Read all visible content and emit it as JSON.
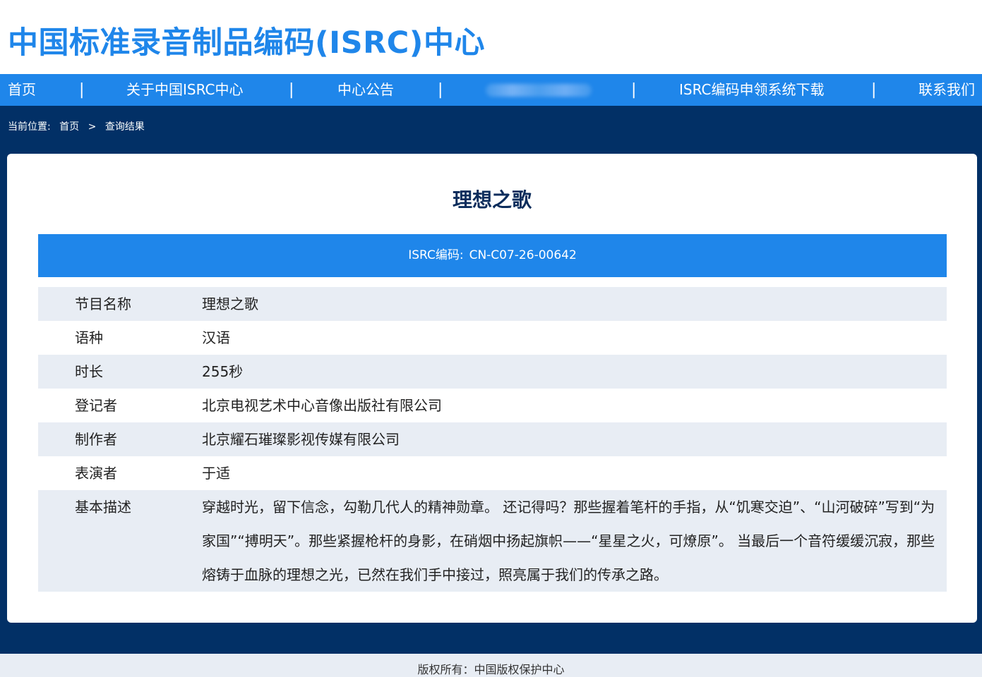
{
  "header": {
    "site_title": "中国标准录音制品编码(ISRC)中心"
  },
  "nav": {
    "items": [
      "首页",
      "关于中国ISRC中心",
      "中心公告",
      "ISRC编码申领系统下载",
      "联系我们"
    ],
    "separator": "|"
  },
  "breadcrumb": {
    "prefix": "当前位置:",
    "home": "首页",
    "arrow": ">",
    "current": "查询结果"
  },
  "record": {
    "title": "理想之歌",
    "isrc_label": "ISRC编码:",
    "isrc_code": "CN-C07-26-00642",
    "fields": [
      {
        "label": "节目名称",
        "value": "理想之歌"
      },
      {
        "label": "语种",
        "value": "汉语"
      },
      {
        "label": "时长",
        "value": "255秒"
      },
      {
        "label": "登记者",
        "value": "北京电视艺术中心音像出版社有限公司"
      },
      {
        "label": "制作者",
        "value": "北京耀石璀璨影视传媒有限公司"
      },
      {
        "label": "表演者",
        "value": "于适"
      },
      {
        "label": "基本描述",
        "value": "穿越时光，留下信念，勾勒几代人的精神勋章。 还记得吗？那些握着笔杆的手指，从“饥寒交迫”、“山河破碎”写到“为家国”“搏明天”。那些紧握枪杆的身影，在硝烟中扬起旗帜——“星星之火，可燎原”。 当最后一个音符缓缓沉寂，那些熔铸于血脉的理想之光，已然在我们手中接过，照亮属于我们的传承之路。"
      }
    ]
  },
  "footer": {
    "copyright": "版权所有：中国版权保护中心"
  },
  "colors": {
    "brand_blue": "#1f86ea",
    "navy": "#023066",
    "row_stripe": "#e8edf4"
  }
}
